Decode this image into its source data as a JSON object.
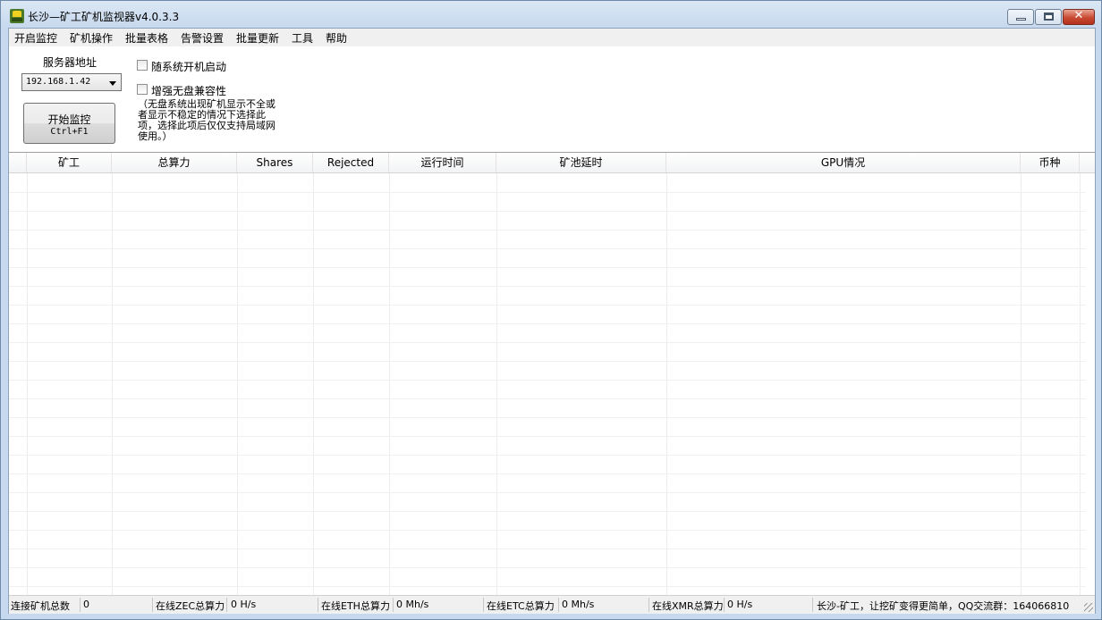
{
  "window": {
    "title": "长沙—矿工矿机监视器v4.0.3.3",
    "controls": {
      "minimize": "minimize",
      "maximize": "maximize",
      "close": "✕"
    }
  },
  "menu": {
    "items": [
      "开启监控",
      "矿机操作",
      "批量表格",
      "告警设置",
      "批量更新",
      "工具",
      "帮助"
    ]
  },
  "panel": {
    "server_label": "服务器地址",
    "server_value": "192.168.1.42",
    "start_button_line1": "开始监控",
    "start_button_line2": "Ctrl+F1",
    "checkbox_autostart": "随系统开机启动",
    "checkbox_diskless": "增强无盘兼容性",
    "note": "（无盘系统出现矿机显示不全或者显示不稳定的情况下选择此项，选择此项后仅仅支持局域网使用。）"
  },
  "grid": {
    "columns": [
      "矿工",
      "总算力",
      "Shares",
      "Rejected",
      "运行时间",
      "矿池延时",
      "GPU情况",
      "币种"
    ]
  },
  "statusbar": {
    "connected_label": "连接矿机总数",
    "connected_value": "0",
    "zec_label": "在线ZEC总算力",
    "zec_value": "0 H/s",
    "eth_label": "在线ETH总算力",
    "eth_value": "0 Mh/s",
    "etc_label": "在线ETC总算力",
    "etc_value": "0 Mh/s",
    "xmr_label": "在线XMR总算力",
    "xmr_value": "0 H/s",
    "slogan": "长沙-矿工，让挖矿变得更简单，QQ交流群：164066810"
  }
}
